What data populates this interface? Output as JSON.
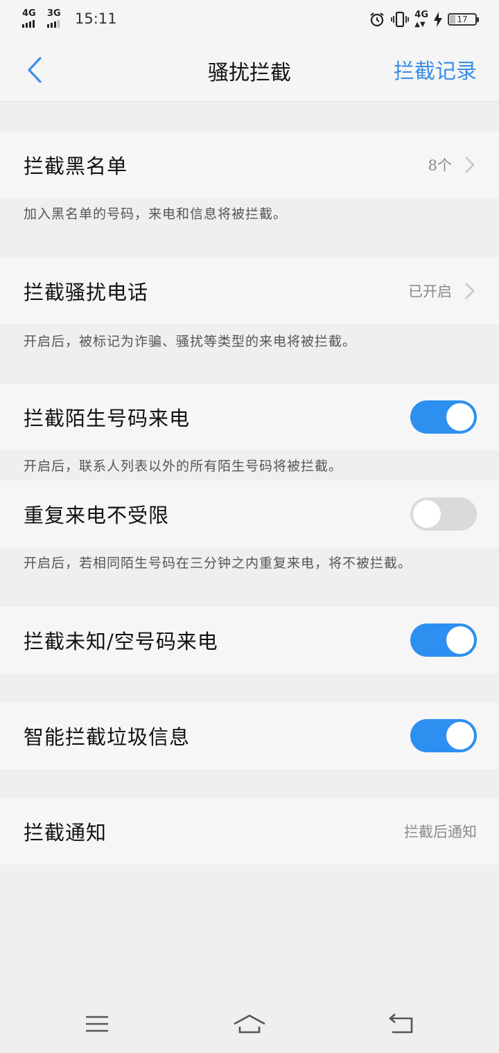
{
  "status_bar": {
    "sim1_network": "4G",
    "sim2_network": "3G",
    "time": "15:11",
    "data_network": "4G",
    "battery_level": "17",
    "icons": [
      "alarm-icon",
      "vibrate-icon",
      "charging-icon"
    ]
  },
  "header": {
    "title": "骚扰拦截",
    "action_label": "拦截记录",
    "accent_color": "#3a8ee6"
  },
  "settings": {
    "blacklist": {
      "label": "拦截黑名单",
      "value": "8个",
      "desc": "加入黑名单的号码，来电和信息将被拦截。"
    },
    "harass_calls": {
      "label": "拦截骚扰电话",
      "value": "已开启",
      "desc": "开启后，被标记为诈骗、骚扰等类型的来电将被拦截。"
    },
    "stranger_calls": {
      "label": "拦截陌生号码来电",
      "on": true,
      "desc": "开启后，联系人列表以外的所有陌生号码将被拦截。"
    },
    "repeat_calls": {
      "label": "重复来电不受限",
      "on": false,
      "desc": "开启后，若相同陌生号码在三分钟之内重复来电，将不被拦截。"
    },
    "unknown_calls": {
      "label": "拦截未知/空号码来电",
      "on": true
    },
    "spam_messages": {
      "label": "智能拦截垃圾信息",
      "on": true
    },
    "notification": {
      "label": "拦截通知",
      "value": "拦截后通知"
    }
  },
  "colors": {
    "toggle_on": "#2d8ff0",
    "toggle_off": "#dadada"
  },
  "nav_bar": {
    "icons": [
      "menu-icon",
      "home-icon",
      "back-icon"
    ]
  }
}
